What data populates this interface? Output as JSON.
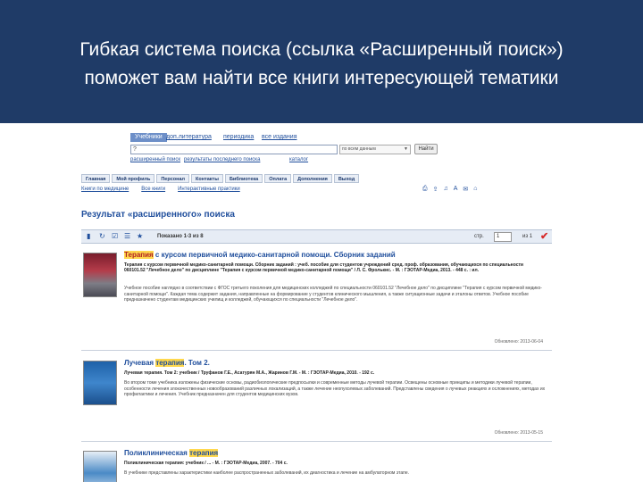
{
  "slide": {
    "line1": "Гибкая система поиска (ссылка «Расширенный поиск»)",
    "line2": "поможет вам найти все книги интересующей тематики"
  },
  "search": {
    "tabs": [
      "Учебники",
      "доп.литература",
      "периодика",
      "все издания"
    ],
    "query": "?",
    "select_value": "по всем данным",
    "button_label": "Найти",
    "links": [
      "расширенный поиск",
      "результаты последнего поиска",
      "каталог"
    ]
  },
  "topnav": [
    "Главная",
    "Мой профиль",
    "Персонал",
    "Контакты",
    "Библиотека",
    "Оплата",
    "Дополнения",
    "Выход"
  ],
  "subnav": [
    "Книги по медицине",
    "Все книги",
    "Интерактивные практики"
  ],
  "result_title": "Результат «расширенного» поиска",
  "result_bar": {
    "shown": "Показано 1-3 из 8",
    "page_label": "стр.",
    "page_value": "1",
    "of": "из 1"
  },
  "items": [
    {
      "title_hl": "Терапия",
      "title_rest": " с курсом первичной медико-санитарной помощи. Сборник заданий",
      "bib": "Терапия с курсом первичной медико-санитарной помощи. Сборник заданий : учеб. пособие для студентов учреждений сред. проф. образования, обучающихся по специальности 060101.52 \"Лечебное дело\" по дисциплине \"Терапия с курсом первичной медико-санитарной помощи\" / Л. С. Фролькис. - М. : ГЭОТАР-Медиа, 2013. - 448 с. : ил.",
      "desc": "Учебное пособие наглядно в соответствии с ФГОС третьего поколения для медицинских колледжей по специальности 060101.52 \"Лечебное дело\" по дисциплине \"Терапия с курсом первичной медико-санитарной помощи\". Каждая тема содержит задания, направленные на формирование у студентов клинического мышления, а также ситуационные задачи и эталоны ответов. Учебное пособие предназначено студентам медицинских училищ и колледжей, обучающихся по специальности \"Лечебное дело\".",
      "date": "Обновлено: 2013-06-04"
    },
    {
      "title_pre": "Лучевая ",
      "title_hl": "терапия",
      "title_rest": ". Том 2.",
      "bib": "Лучевая терапия. Том 2: учебник / Труфанов Г.Е., Асатурян М.А., Жаринов Г.М. - М. : ГЭОТАР-Медиа, 2010. - 192 с.",
      "desc": "Во втором томе учебника изложены физические основы, радиобиологические предпосылки и современные методы лучевой терапии. Освещены основные принципы и методики лучевой терапии, особенности лечения злокачественных новообразований различных локализаций, а также лечение неопухолевых заболеваний. Представлены сведения о лучевых реакциях и осложнениях, методах их профилактики и лечения. Учебник предназначен для студентов медицинских вузов.",
      "date": "Обновлено: 2013-05-15"
    },
    {
      "title_pre": "Поликлиническая ",
      "title_hl": "терапия",
      "title_rest": "",
      "bib": "Поликлиническая терапия: учебник / ... - М. : ГЭОТАР-Медиа, 2007. - 704 с.",
      "desc": "В учебнике представлены характеристики наиболее распространенных заболеваний, их диагностика и лечение на амбулаторном этапе.",
      "date": ""
    }
  ]
}
